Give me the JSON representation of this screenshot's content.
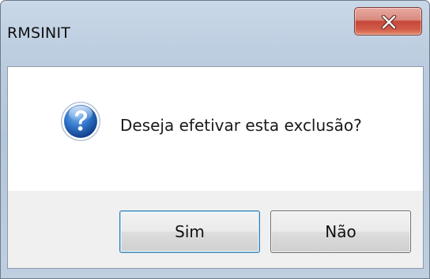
{
  "window": {
    "title": "RMSINIT",
    "close_icon": "close-icon"
  },
  "dialog": {
    "icon": "question-icon",
    "message": "Deseja efetivar esta exclusão?"
  },
  "buttons": {
    "yes_label": "Sim",
    "no_label": "Não"
  },
  "colors": {
    "close_button": "#c6473a",
    "question_icon": "#1e5fb4"
  }
}
